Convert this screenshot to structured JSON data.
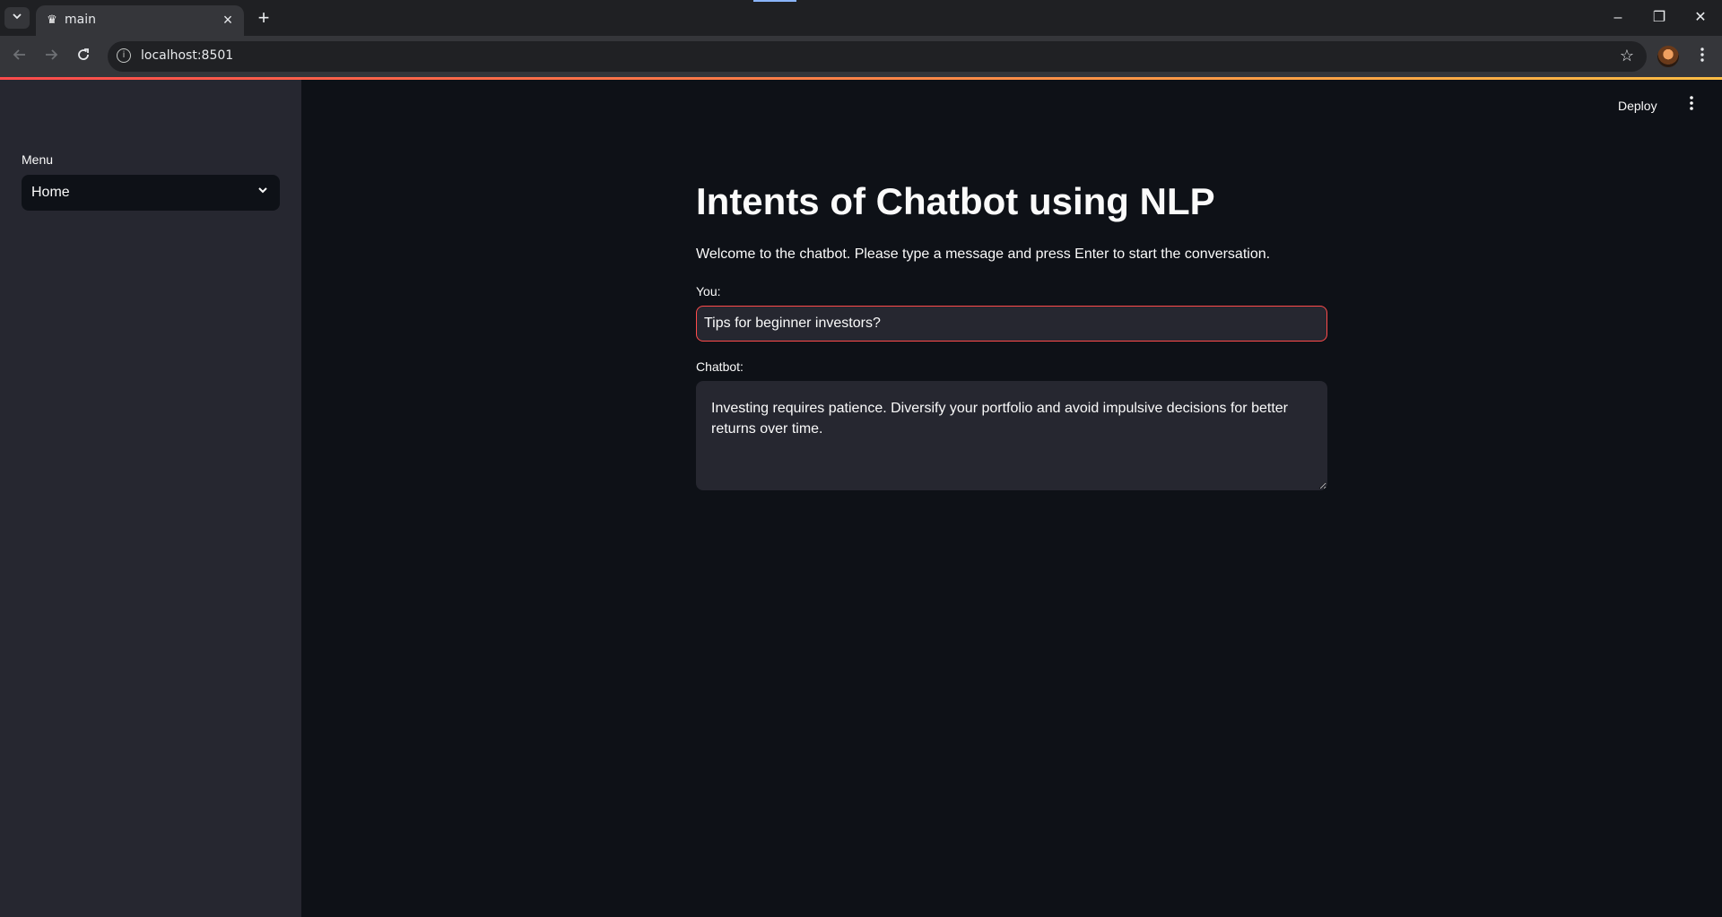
{
  "browser": {
    "tab_title": "main",
    "url": "localhost:8501",
    "icons": {
      "tab_search": "chevron-down-icon",
      "favicon": "streamlit-crown-icon",
      "tab_close": "close-icon",
      "new_tab": "plus-icon",
      "back": "arrow-left-icon",
      "forward": "arrow-right-icon",
      "reload": "reload-icon",
      "site_info": "info-icon",
      "bookmark": "star-icon",
      "menu": "vertical-dots-icon"
    }
  },
  "sidebar": {
    "menu_label": "Menu",
    "select_value": "Home"
  },
  "header": {
    "deploy_label": "Deploy"
  },
  "main": {
    "title": "Intents of Chatbot using NLP",
    "welcome": "Welcome to the chatbot. Please type a message and press Enter to start the conversation.",
    "you_label": "You:",
    "you_value": "Tips for beginner investors?",
    "chatbot_label": "Chatbot:",
    "chatbot_value": "Investing requires patience. Diversify your portfolio and avoid impulsive decisions for better returns over time."
  },
  "colors": {
    "app_background": "#0e1117",
    "sidebar_background": "#262730",
    "input_background": "#262730",
    "focus_border": "#ff4b4b",
    "text": "#fafafa"
  }
}
